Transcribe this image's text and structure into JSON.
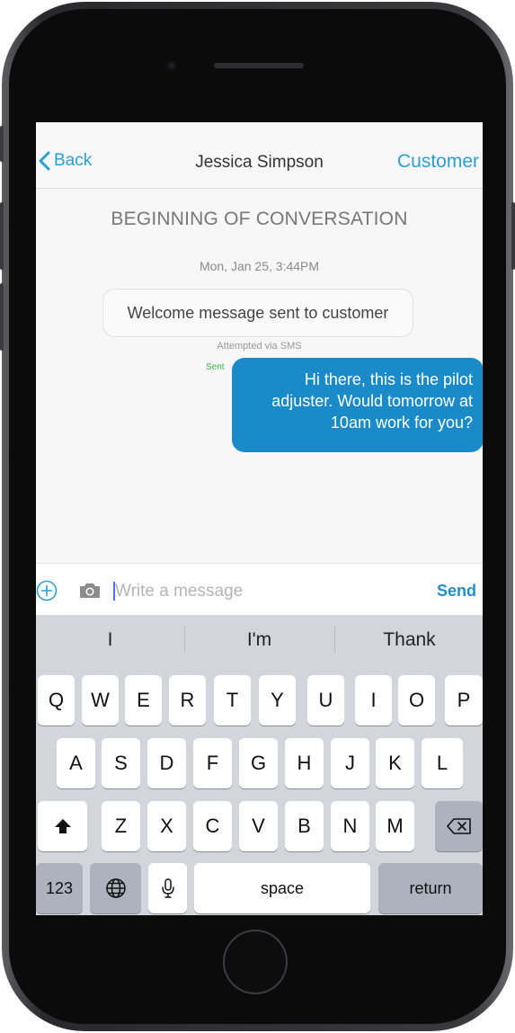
{
  "navbar": {
    "back_label": "Back",
    "title": "Jessica Simpson",
    "right_label": "Customer"
  },
  "conversation": {
    "header": "BEGINNING OF CONVERSATION",
    "timestamp": "Mon, Jan 25, 3:44PM",
    "system_message": "Welcome message sent to customer",
    "system_note": "Attempted via SMS",
    "sent_status": "Sent",
    "outgoing_message": "Hi there, this is the pilot adjuster. Would tomorrow at 10am work for you?"
  },
  "composer": {
    "placeholder": "Write a message",
    "send_label": "Send"
  },
  "keyboard": {
    "predictions": [
      "I",
      "I'm",
      "Thank"
    ],
    "row1": [
      "Q",
      "W",
      "E",
      "R",
      "T",
      "Y",
      "U",
      "I",
      "O",
      "P"
    ],
    "row2": [
      "A",
      "S",
      "D",
      "F",
      "G",
      "H",
      "J",
      "K",
      "L"
    ],
    "row3": [
      "Z",
      "X",
      "C",
      "V",
      "B",
      "N",
      "M"
    ],
    "numbers_label": "123",
    "space_label": "space",
    "return_label": "return"
  },
  "colors": {
    "accent": "#2a9fd6",
    "outgoing_bubble": "#1a8bc8",
    "sent_status": "#39b54a"
  }
}
